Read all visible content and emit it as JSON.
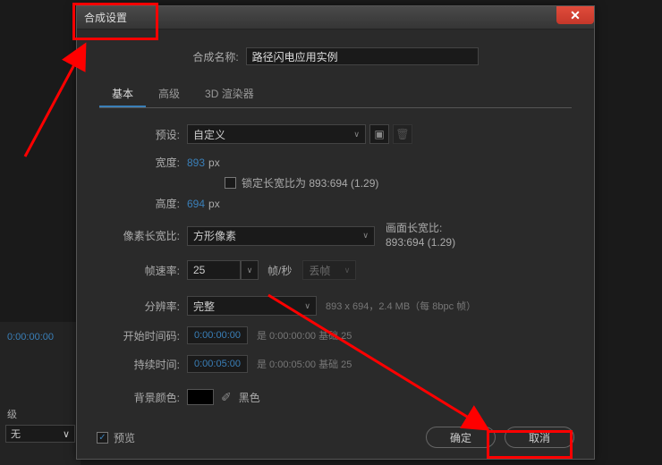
{
  "bg": {
    "timecode": "0:00:00:00",
    "level_label": "级",
    "dropdown_value": "无"
  },
  "dialog": {
    "title": "合成设置",
    "comp_name_label": "合成名称:",
    "comp_name_value": "路径闪电应用实例",
    "tabs": [
      "基本",
      "高级",
      "3D 渲染器"
    ],
    "preset_label": "预设:",
    "preset_value": "自定义",
    "width_label": "宽度:",
    "width_value": "893",
    "width_unit": "px",
    "height_label": "高度:",
    "height_value": "694",
    "height_unit": "px",
    "lock_aspect_label": "锁定长宽比为 893:694 (1.29)",
    "pixel_aspect_label": "像素长宽比:",
    "pixel_aspect_value": "方形像素",
    "frame_aspect_label": "画面长宽比:",
    "frame_aspect_value": "893:694 (1.29)",
    "framerate_label": "帧速率:",
    "framerate_value": "25",
    "framerate_unit": "帧/秒",
    "dropframe_value": "丢帧",
    "resolution_label": "分辨率:",
    "resolution_value": "完整",
    "resolution_info": "893 x 694，2.4 MB（每 8bpc 帧）",
    "start_tc_label": "开始时间码:",
    "start_tc_value": "0:00:00:00",
    "start_tc_info": "是 0:00:00:00  基础 25",
    "duration_label": "持续时间:",
    "duration_value": "0:00:05:00",
    "duration_info": "是 0:00:05:00  基础 25",
    "bg_color_label": "背景颜色:",
    "bg_color_name": "黑色",
    "preview_label": "预览",
    "ok_button": "确定",
    "cancel_button": "取消"
  }
}
